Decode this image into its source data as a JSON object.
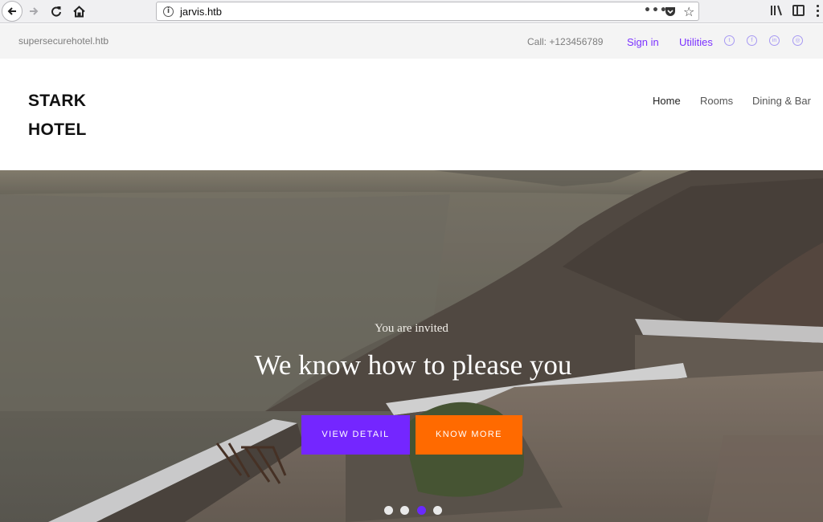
{
  "browser": {
    "url": "jarvis.htb",
    "page_actions_icon": "•••",
    "star_icon": "☆",
    "info_icon": "i"
  },
  "topbar": {
    "site": "supersecurehotel.htb",
    "call": "Call: +123456789",
    "sign_in": "Sign in",
    "utilities": "Utilities",
    "social_icons": [
      "twitter-icon",
      "facebook-icon",
      "linkedin-icon",
      "dribbble-icon"
    ]
  },
  "header": {
    "logo": "STARK HOTEL",
    "nav": {
      "home": "Home",
      "rooms": "Rooms",
      "dining": "Dining & Bar"
    }
  },
  "hero": {
    "subtitle": "You are invited",
    "title": "We know how to please you",
    "view_button": "VIEW DETAIL",
    "know_button": "KNOW MORE",
    "slide_count": 4,
    "active_slide": 3
  },
  "colors": {
    "accent_purple": "#7426ff",
    "accent_orange": "#ff6a00",
    "link_purple": "#7b32ff"
  }
}
